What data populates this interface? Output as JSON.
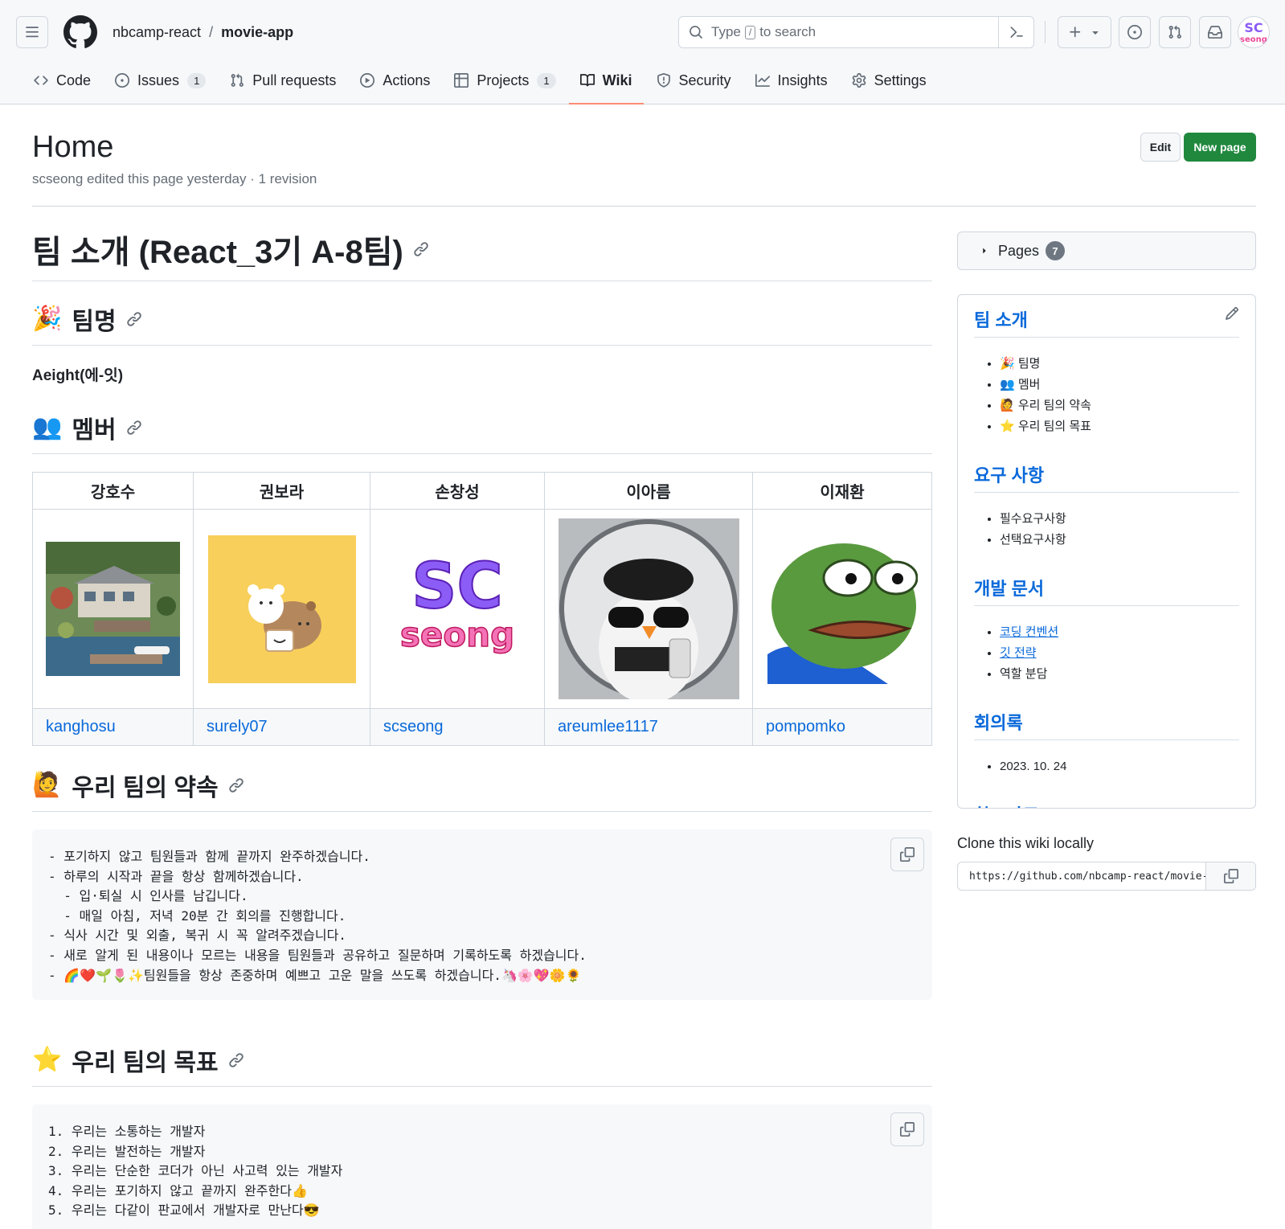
{
  "header": {
    "owner": "nbcamp-react",
    "separator": "/",
    "repo": "movie-app",
    "search_prefix": "Type",
    "search_key": "/",
    "search_suffix": "to search"
  },
  "tabs": [
    {
      "label": "Code",
      "icon": "code-icon"
    },
    {
      "label": "Issues",
      "count": "1",
      "icon": "issue-icon"
    },
    {
      "label": "Pull requests",
      "icon": "pull-request-icon"
    },
    {
      "label": "Actions",
      "icon": "play-icon"
    },
    {
      "label": "Projects",
      "count": "1",
      "icon": "table-icon"
    },
    {
      "label": "Wiki",
      "icon": "book-icon",
      "active": true
    },
    {
      "label": "Security",
      "icon": "shield-icon"
    },
    {
      "label": "Insights",
      "icon": "graph-icon"
    },
    {
      "label": "Settings",
      "icon": "gear-icon"
    }
  ],
  "page": {
    "title": "Home",
    "meta": "scseong edited this page yesterday · 1 revision",
    "edit_label": "Edit",
    "new_page_label": "New page"
  },
  "content": {
    "h1": "팀 소개 (React_3기 A-8팀)",
    "team_heading": "팀명",
    "team_emoji": "🎉",
    "team_name": "Aeight(에-잇)",
    "member_heading": "멤버",
    "member_emoji": "👥",
    "members": [
      {
        "name": "강호수",
        "github": "kanghosu",
        "picture": "mansion-photo"
      },
      {
        "name": "권보라",
        "github": "surely07",
        "picture": "bear-illustration"
      },
      {
        "name": "손창성",
        "github": "scseong",
        "picture": "sc-seong-logo"
      },
      {
        "name": "이아름",
        "github": "areumlee1117",
        "picture": "penguin-mirror-photo"
      },
      {
        "name": "이재환",
        "github": "pompomko",
        "picture": "pepe-frog"
      }
    ],
    "promise_heading": "우리 팀의 약속",
    "promise_emoji": "🙋",
    "promise_lines": [
      "- 포기하지 않고 팀원들과 함께 끝까지 완주하겠습니다.",
      "- 하루의 시작과 끝을 항상 함께하겠습니다.",
      "  - 입·퇴실 시 인사를 남깁니다.",
      "  - 매일 아침, 저녁 20분 간 회의를 진행합니다.",
      "- 식사 시간 및 외출, 복귀 시 꼭 알려주겠습니다.",
      "- 새로 알게 된 내용이나 모르는 내용을 팀원들과 공유하고 질문하며 기록하도록 하겠습니다.",
      "- 🌈❤️🌱🌷✨팀원들을 항상 존중하며 예쁘고 고운 말을 쓰도록 하겠습니다.🦄🌸💖🌼🌻"
    ],
    "goal_heading": "우리 팀의 목표",
    "goal_emoji": "⭐",
    "goal_lines": [
      "1. 우리는 소통하는 개발자",
      "2. 우리는 발전하는 개발자",
      "3. 우리는 단순한 코더가 아닌 사고력 있는 개발자",
      "4. 우리는 포기하지 않고 끝까지 완주한다👍",
      "5. 우리는 다같이 판교에서 개발자로 만난다😎"
    ]
  },
  "sidebar": {
    "pages_label": "Pages",
    "pages_count": "7",
    "sections": [
      {
        "title": "팀 소개",
        "items": [
          {
            "text": "🎉 팀명",
            "link": false
          },
          {
            "text": "👥 멤버",
            "link": false
          },
          {
            "text": "🙋 우리 팀의 약속",
            "link": false
          },
          {
            "text": "⭐ 우리 팀의 목표",
            "link": false
          }
        ]
      },
      {
        "title": "요구 사항",
        "items": [
          {
            "text": "필수요구사항",
            "link": false
          },
          {
            "text": "선택요구사항",
            "link": false
          }
        ]
      },
      {
        "title": "개발 문서",
        "items": [
          {
            "text": "코딩 컨벤션",
            "link": true
          },
          {
            "text": "깃 전략",
            "link": true
          },
          {
            "text": "역할 분담",
            "link": false
          }
        ]
      },
      {
        "title": "회의록",
        "items": [
          {
            "text": "2023. 10. 24",
            "link": false
          }
        ]
      },
      {
        "title": "참고자료",
        "items": []
      }
    ],
    "clone_label": "Clone this wiki locally",
    "clone_url": "https://github.com/nbcamp-react/movie-app.wiki.git"
  },
  "colors": {
    "accent": "#0969da",
    "primary_button": "#1f883d",
    "active_tab_underline": "#fd8c73",
    "code_bg": "#f6f8fa"
  }
}
